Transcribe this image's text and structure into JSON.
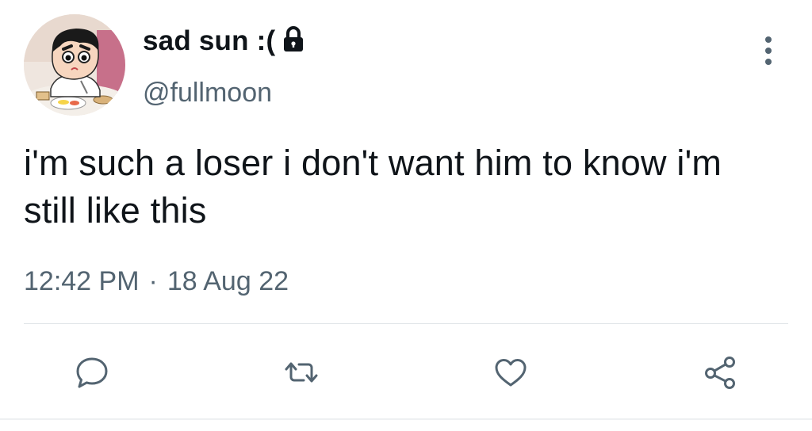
{
  "user": {
    "display_name": "sad sun :(",
    "handle": "@fullmoon",
    "verified_lock": "lock-icon"
  },
  "tweet": {
    "text": "i'm such a loser i don't want him to know i'm still like this",
    "time": "12:42 PM",
    "separator": "·",
    "date": "18 Aug 22"
  },
  "actions": [
    {
      "name": "reply",
      "icon": "comment-icon"
    },
    {
      "name": "retweet",
      "icon": "retweet-icon"
    },
    {
      "name": "like",
      "icon": "heart-icon"
    },
    {
      "name": "share",
      "icon": "share-icon"
    }
  ],
  "colors": {
    "text_primary": "#0f1419",
    "text_secondary": "#536471",
    "divider": "#e1e5e8"
  }
}
